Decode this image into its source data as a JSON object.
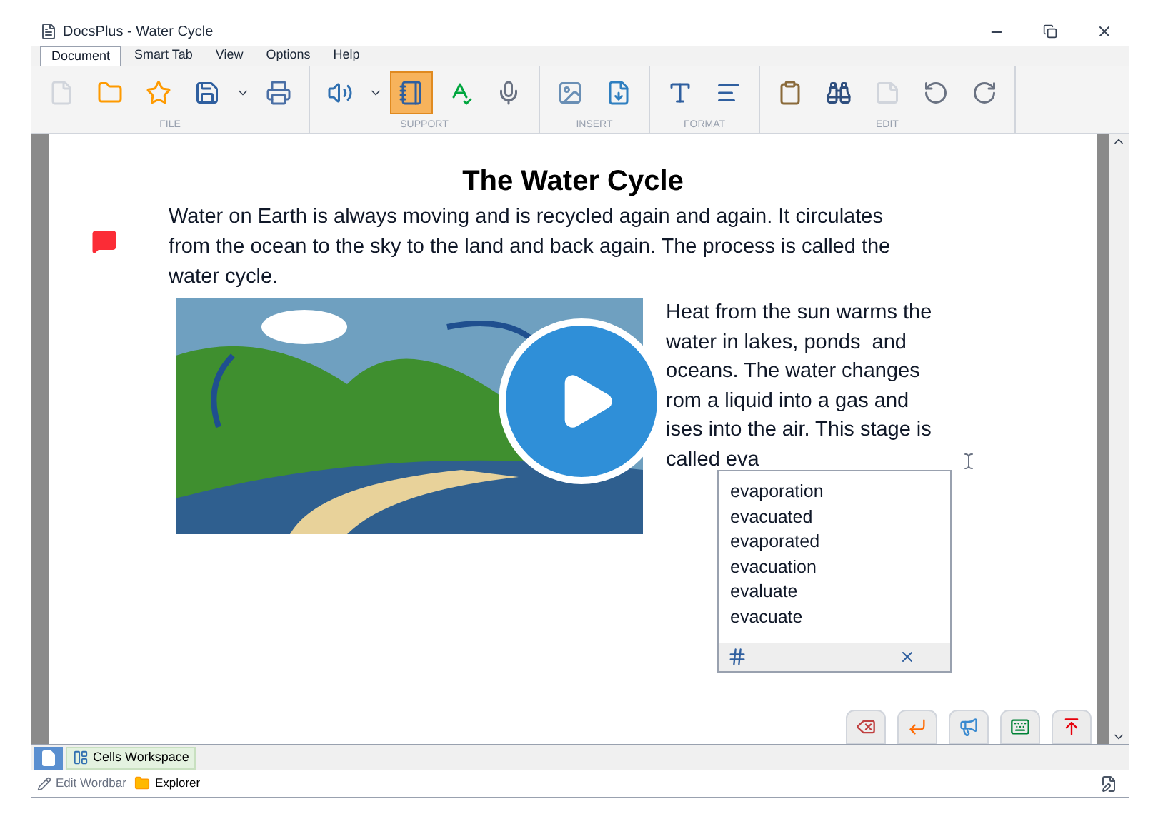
{
  "window": {
    "title": "DocsPlus - Water Cycle"
  },
  "menu_tabs": [
    {
      "label": "Document",
      "selected": true
    },
    {
      "label": "Smart Tab",
      "selected": false
    },
    {
      "label": "View",
      "selected": false
    },
    {
      "label": "Options",
      "selected": false
    },
    {
      "label": "Help",
      "selected": false
    }
  ],
  "toolbar": [
    {
      "label": "FILE",
      "buttons": [
        {
          "kind": "new",
          "selected": false
        },
        {
          "kind": "open",
          "selected": false
        },
        {
          "kind": "favorite",
          "selected": false
        },
        {
          "kind": "save",
          "selected": false
        },
        {
          "kind": "dropdown",
          "selected": false
        },
        {
          "kind": "print",
          "selected": false
        }
      ]
    },
    {
      "label": "SUPPORT",
      "buttons": [
        {
          "kind": "speak",
          "selected": false
        },
        {
          "kind": "dropdown",
          "selected": false
        },
        {
          "kind": "read",
          "selected": true
        },
        {
          "kind": "spellcheck",
          "selected": false
        },
        {
          "kind": "dictate",
          "selected": false
        }
      ]
    },
    {
      "label": "INSERT",
      "buttons": [
        {
          "kind": "image",
          "selected": false
        },
        {
          "kind": "insert-file",
          "selected": false
        }
      ]
    },
    {
      "label": "FORMAT",
      "buttons": [
        {
          "kind": "font",
          "selected": false
        },
        {
          "kind": "align",
          "selected": false
        }
      ]
    },
    {
      "label": "EDIT",
      "buttons": [
        {
          "kind": "paste",
          "selected": false
        },
        {
          "kind": "find",
          "selected": false
        },
        {
          "kind": "note",
          "selected": false
        },
        {
          "kind": "undo",
          "selected": false
        },
        {
          "kind": "redo",
          "selected": false
        }
      ]
    }
  ],
  "document": {
    "title": "The Water Cycle",
    "paragraph": "Water on Earth is always moving and is recycled again and again. It circulates from the ocean to the sky to the land and back again. The process is called the water cycle.",
    "side_text": [
      "Heat from the sun warms the",
      "water in lakes, ponds  and",
      "oceans. The water changes",
      "rom a liquid into a gas and",
      "ises into the air. This stage is",
      "called eva"
    ],
    "autocomplete": {
      "suggestions": [
        "evaporation",
        "evacuated",
        "evaporated",
        "evacuation",
        "evaluate",
        "evacuate"
      ]
    }
  },
  "action_buttons": [
    {
      "kind": "backspace"
    },
    {
      "kind": "enter"
    },
    {
      "kind": "speak"
    },
    {
      "kind": "keyboard"
    },
    {
      "kind": "top"
    }
  ],
  "bottom_tabs": [
    {
      "kind": "page",
      "selected": true
    },
    {
      "kind": "workspace",
      "label": "Cells Workspace",
      "selected": false
    }
  ],
  "status_bar": {
    "items": [
      {
        "kind": "edit",
        "label": "Edit Wordbar"
      },
      {
        "kind": "folder",
        "label": "Explorer"
      }
    ]
  }
}
